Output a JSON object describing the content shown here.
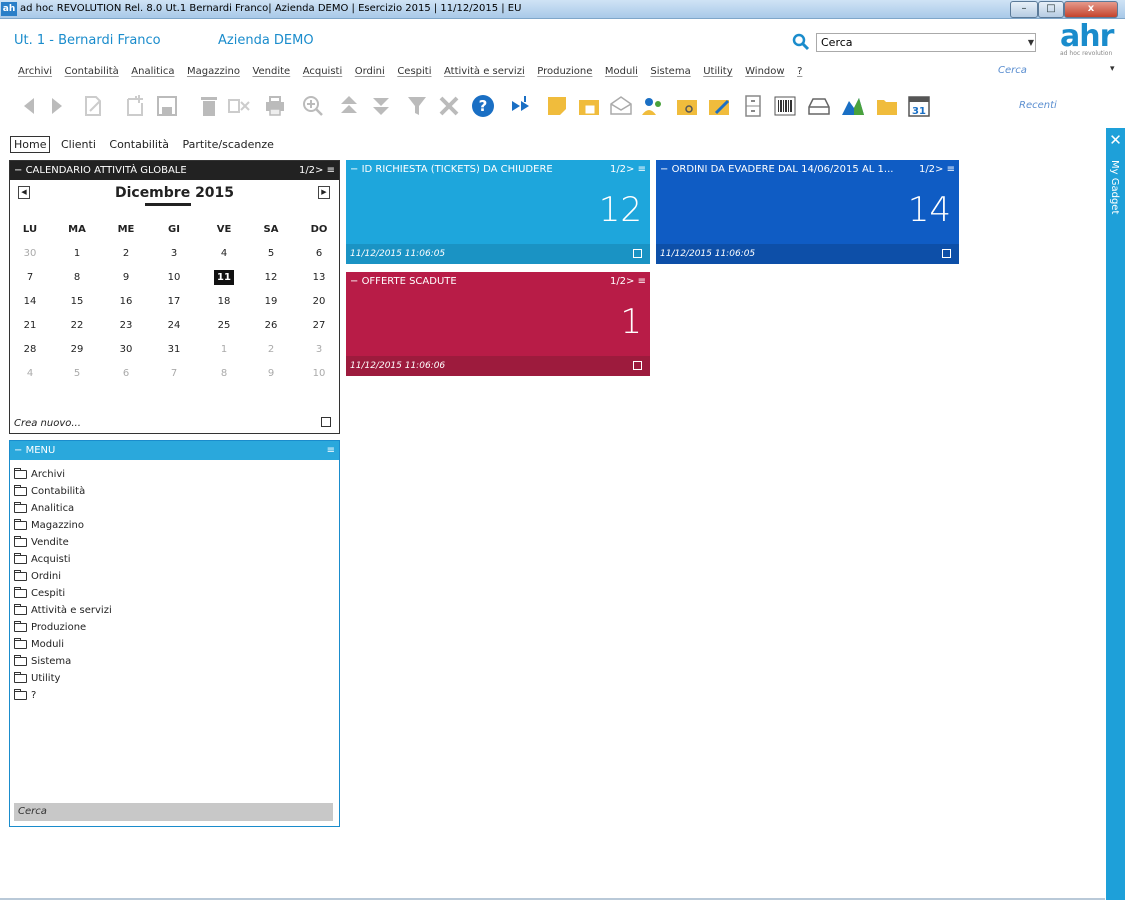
{
  "window": {
    "icon_label": "ah",
    "title": "ad hoc REVOLUTION Rel. 8.0 Ut.1 Bernardi Franco| Azienda DEMO | Esercizio 2015 | 11/12/2015 | EU",
    "minimize": "–",
    "maximize": "□",
    "close": "x"
  },
  "header": {
    "user": "Ut. 1 - Bernardi Franco",
    "company": "Azienda DEMO",
    "search_value": "Cerca",
    "logo_text": "ahr",
    "logo_sub": "ad hoc revolution"
  },
  "menubar": {
    "items": [
      "Archivi",
      "Contabilità",
      "Analitica",
      "Magazzino",
      "Vendite",
      "Acquisti",
      "Ordini",
      "Cespiti",
      "Attività e servizi",
      "Produzione",
      "Moduli",
      "Sistema",
      "Utility",
      "Window",
      "?"
    ],
    "cerca": "Cerca",
    "arrow": "▾"
  },
  "toolbar": {
    "recenti": "Recenti",
    "calendar_day": "31"
  },
  "tabs": [
    "Home",
    "Clienti",
    "Contabilità",
    "Partite/scadenze"
  ],
  "gadget": {
    "close": "✕",
    "label": "My Gadget"
  },
  "calendar": {
    "title": "CALENDARIO ATTIVITÀ GLOBALE",
    "page": "1/2>",
    "month": "Dicembre 2015",
    "prev": "◀",
    "next": "▶",
    "weekdays": [
      "LU",
      "MA",
      "ME",
      "GI",
      "VE",
      "SA",
      "DO"
    ],
    "weeks": [
      [
        "30",
        "1",
        "2",
        "3",
        "4",
        "5",
        "6"
      ],
      [
        "7",
        "8",
        "9",
        "10",
        "11",
        "12",
        "13"
      ],
      [
        "14",
        "15",
        "16",
        "17",
        "18",
        "19",
        "20"
      ],
      [
        "21",
        "22",
        "23",
        "24",
        "25",
        "26",
        "27"
      ],
      [
        "28",
        "29",
        "30",
        "31",
        "1",
        "2",
        "3"
      ],
      [
        "4",
        "5",
        "6",
        "7",
        "8",
        "9",
        "10"
      ]
    ],
    "today": "11",
    "create_new": "Crea nuovo..."
  },
  "menu_panel": {
    "title": "MENU",
    "items": [
      "Archivi",
      "Contabilità",
      "Analitica",
      "Magazzino",
      "Vendite",
      "Acquisti",
      "Ordini",
      "Cespiti",
      "Attività e servizi",
      "Produzione",
      "Moduli",
      "Sistema",
      "Utility",
      "?"
    ],
    "search": "Cerca"
  },
  "tiles": [
    {
      "title": "ID RICHIESTA (TICKETS) DA CHIUDERE",
      "page": "1/2>",
      "value": "12",
      "timestamp": "11/12/2015 11:06:05",
      "color": "#1ea6dc",
      "foot_color": "#1a93c4"
    },
    {
      "title": "ORDINI DA EVADERE DAL 14/06/2015 AL 1...",
      "page": "1/2>",
      "value": "14",
      "timestamp": "11/12/2015 11:06:05",
      "color": "#0f5cc4",
      "foot_color": "#0d4fa8"
    },
    {
      "title": "OFFERTE SCADUTE",
      "page": "1/2>",
      "value": "1",
      "timestamp": "11/12/2015 11:06:06",
      "color": "#b81c47",
      "foot_color": "#9d1b3d"
    }
  ]
}
